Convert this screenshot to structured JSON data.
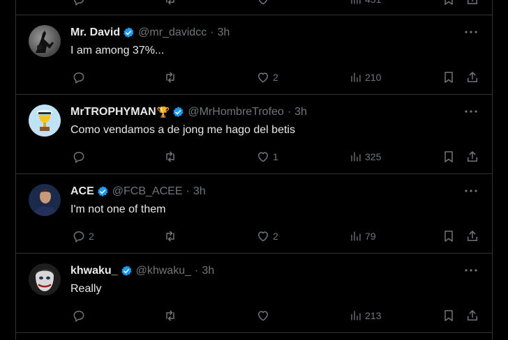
{
  "top_partial": {
    "views": "451"
  },
  "tweets": [
    {
      "name": "Mr. David",
      "emoji": "",
      "handle": "@mr_davidcc",
      "time": "3h",
      "text": "I am among 37%...",
      "replies": "",
      "retweets": "",
      "likes": "2",
      "views": "210",
      "avatar_icon": "silhouette-avatar"
    },
    {
      "name": "MrTROPHYMAN",
      "emoji": "🏆",
      "handle": "@MrHombreTrofeo",
      "time": "3h",
      "text": "Como vendamos a de jong me hago del betis",
      "replies": "",
      "retweets": "",
      "likes": "1",
      "views": "325",
      "avatar_icon": "trophy-avatar"
    },
    {
      "name": "ACE",
      "emoji": "",
      "handle": "@FCB_ACEE",
      "time": "3h",
      "text": "I'm not one of them",
      "replies": "2",
      "retweets": "",
      "likes": "2",
      "views": "79",
      "avatar_icon": "player-avatar"
    },
    {
      "name": "khwaku_",
      "emoji": "",
      "handle": "@khwaku_",
      "time": "3h",
      "text": "Really",
      "replies": "",
      "retweets": "",
      "likes": "",
      "views": "213",
      "avatar_icon": "joker-avatar"
    }
  ],
  "colors": {
    "background": "#000000",
    "border": "#2f3336",
    "text": "#e7e9ea",
    "muted": "#71767b",
    "verified": "#1d9bf0"
  },
  "icons": {
    "verified": "verified-badge-icon",
    "more": "more-dots-icon",
    "reply": "reply-icon",
    "retweet": "retweet-icon",
    "like": "heart-icon",
    "views": "views-icon",
    "bookmark": "bookmark-icon",
    "share": "share-icon"
  }
}
